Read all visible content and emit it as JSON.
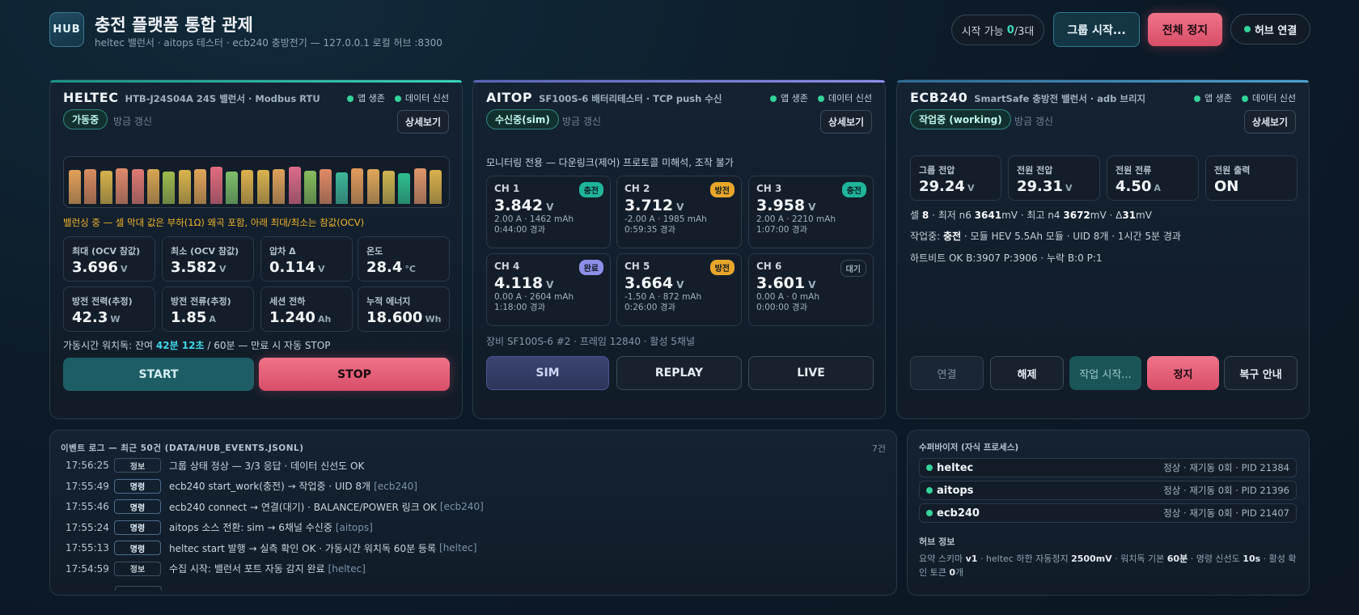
{
  "header": {
    "logo": "HUB",
    "title": "충전 플랫폼 통합 관제",
    "subtitle": "heltec 밸런서 · aitops 테스터 · ecb240 충방전기 — 127.0.0.1 로컬 허브 :8300",
    "start_avail_label": "시작 가능",
    "start_avail_count": "0",
    "start_avail_total": "/3대",
    "group_start": "그룹 시작...",
    "stop_all": "전체 정지",
    "hub_link": "허브 연결"
  },
  "heltec": {
    "name": "HELTEC",
    "desc": "HTB-J24S04A 24S 밸런서 · Modbus RTU",
    "alive": "앱 생존",
    "fresh": "데이터 신선",
    "state": "가동중",
    "refresh": "방금 갱신",
    "detail": "상세보기",
    "note": "밸런싱 중 — 셀 막대 값은 부하(1Ω) 왜곡 포함, 아래 최대/최소는 참값(OCV)",
    "stats": [
      {
        "label": "최대 (OCV 참값)",
        "value": "3.696",
        "unit": "V"
      },
      {
        "label": "최소 (OCV 참값)",
        "value": "3.582",
        "unit": "V"
      },
      {
        "label": "압차 Δ",
        "value": "0.114",
        "unit": "V"
      },
      {
        "label": "온도",
        "value": "28.4",
        "unit": "°C"
      },
      {
        "label": "방전 전력(추정)",
        "value": "42.3",
        "unit": "W"
      },
      {
        "label": "방전 전류(추정)",
        "value": "1.85",
        "unit": "A"
      },
      {
        "label": "세션 전하",
        "value": "1.240",
        "unit": "Ah"
      },
      {
        "label": "누적 에너지",
        "value": "18.600",
        "unit": "Wh"
      }
    ],
    "watchdog_pre": "가동시간 워치독: 잔여",
    "watchdog_time": "42분 12초",
    "watchdog_post": "/ 60분 — 만료 시 자동 STOP",
    "start": "START",
    "stop": "STOP",
    "cell_bars": [
      {
        "level": 0.78,
        "color": "#e3a15a"
      },
      {
        "level": 0.8,
        "color": "#d98b5f"
      },
      {
        "level": 0.76,
        "color": "#d6b24a"
      },
      {
        "level": 0.82,
        "color": "#e0896a"
      },
      {
        "level": 0.8,
        "color": "#e07a72"
      },
      {
        "level": 0.79,
        "color": "#d8a552"
      },
      {
        "level": 0.74,
        "color": "#9dbb4e"
      },
      {
        "level": 0.78,
        "color": "#d9b44b"
      },
      {
        "level": 0.79,
        "color": "#e2a458"
      },
      {
        "level": 0.85,
        "color": "#e16b7e"
      },
      {
        "level": 0.74,
        "color": "#7ec06a"
      },
      {
        "level": 0.78,
        "color": "#dcb14c"
      },
      {
        "level": 0.77,
        "color": "#dab24e"
      },
      {
        "level": 0.8,
        "color": "#dfa25b"
      },
      {
        "level": 0.86,
        "color": "#dc6b88"
      },
      {
        "level": 0.75,
        "color": "#86bd5d"
      },
      {
        "level": 0.8,
        "color": "#e08a66"
      },
      {
        "level": 0.72,
        "color": "#3fb69a"
      },
      {
        "level": 0.82,
        "color": "#e29c5d"
      },
      {
        "level": 0.8,
        "color": "#dfa75a"
      },
      {
        "level": 0.76,
        "color": "#cdb650"
      },
      {
        "level": 0.7,
        "color": "#2fbf8f"
      },
      {
        "level": 0.81,
        "color": "#e0966a"
      },
      {
        "level": 0.78,
        "color": "#d9b14b"
      }
    ]
  },
  "aitop": {
    "name": "AITOP",
    "desc": "SF100S-6 배터리테스터 · TCP push 수신",
    "alive": "앱 생존",
    "fresh": "데이터 신선",
    "state": "수신중(sim)",
    "refresh": "방금 갱신",
    "detail": "상세보기",
    "note": "모니터링 전용 — 다운링크(제어) 프로토콜 미해석, 조작 불가",
    "channels": [
      {
        "name": "CH 1",
        "badge": "충전",
        "voltage": "3.842",
        "unit": "V",
        "line1": "2.00 A · 1462 mAh",
        "line2": "0:44:00 경과",
        "badge_color": "#1fb59a"
      },
      {
        "name": "CH 2",
        "badge": "방전",
        "voltage": "3.712",
        "unit": "V",
        "line1": "-2.00 A · 1985 mAh",
        "line2": "0:59:35 경과",
        "badge_color": "#e8a72b"
      },
      {
        "name": "CH 3",
        "badge": "충전",
        "voltage": "3.958",
        "unit": "V",
        "line1": "2.00 A · 2210 mAh",
        "line2": "1:07:00 경과",
        "badge_color": "#1fb59a"
      },
      {
        "name": "CH 4",
        "badge": "완료",
        "voltage": "4.118",
        "unit": "V",
        "line1": "0.00 A · 2604 mAh",
        "line2": "1:18:00 경과",
        "badge_color": "#8d8ee8"
      },
      {
        "name": "CH 5",
        "badge": "방전",
        "voltage": "3.664",
        "unit": "V",
        "line1": "-1.50 A · 872 mAh",
        "line2": "0:26:00 경과",
        "badge_color": "#e8a72b"
      },
      {
        "name": "CH 6",
        "badge": "대기",
        "voltage": "3.601",
        "unit": "V",
        "line1": "0.00 A · 0 mAh",
        "line2": "0:00:00 경과",
        "badge_color": "#3a4a5c"
      }
    ],
    "footer": "장비 SF100S-6 #2 · 프레임 12840 · 활성 5채널",
    "sim": "SIM",
    "replay": "REPLAY",
    "live": "LIVE"
  },
  "ecb": {
    "name": "ECB240",
    "desc": "SmartSafe 충방전 밸런서 · adb 브리지",
    "alive": "앱 생존",
    "fresh": "데이터 신선",
    "state": "작업중 (working)",
    "refresh": "방금 갱신",
    "detail": "상세보기",
    "stats": [
      {
        "label": "그룹 전압",
        "value": "29.24",
        "unit": "V"
      },
      {
        "label": "전원 전압",
        "value": "29.31",
        "unit": "V"
      },
      {
        "label": "전원 전류",
        "value": "4.50",
        "unit": "A"
      },
      {
        "label": "전원 출력",
        "value": "ON",
        "unit": ""
      }
    ],
    "cells_line": {
      "p1": "셀",
      "cells": "8",
      "p2": "· 최저 n6",
      "min": "3641",
      "p3": "mV · 최고 n4",
      "max": "3672",
      "p4": "mV · Δ",
      "delta": "31",
      "p5": "mV"
    },
    "work_line": {
      "p1": "작업중:",
      "mode": "충전",
      "p2": "· 모듈 HEV 5.5Ah 모듈 · UID 8개 · 1시간 5분 경과"
    },
    "heartbeat": "하트비트 OK B:3907 P:3906 · 누락 B:0 P:1",
    "btn_connect": "연결",
    "btn_release": "해제",
    "btn_work": "작업 시작...",
    "btn_stop": "정지",
    "btn_recover": "복구 안내"
  },
  "log": {
    "title": "이벤트 로그 — 최근 50건 (DATA/HUB_EVENTS.JSONL)",
    "count": "7건",
    "rows": [
      {
        "time": "17:56:25",
        "kind": "정보",
        "msg": "그룹 상태 정상 — 3/3 응답 · 데이터 신선도 OK",
        "src": ""
      },
      {
        "time": "17:55:49",
        "kind": "명령",
        "msg": "ecb240 start_work(충전) → 작업중 · UID 8개",
        "src": "[ecb240]"
      },
      {
        "time": "17:55:46",
        "kind": "명령",
        "msg": "ecb240 connect → 연결(대기) · BALANCE/POWER 링크 OK",
        "src": "[ecb240]"
      },
      {
        "time": "17:55:24",
        "kind": "명령",
        "msg": "aitops 소스 전환: sim → 6채널 수신중",
        "src": "[aitops]"
      },
      {
        "time": "17:55:13",
        "kind": "명령",
        "msg": "heltec start 발행 → 실측 확인 OK · 가동시간 워치독 60분 등록",
        "src": "[heltec]"
      },
      {
        "time": "17:54:59",
        "kind": "정보",
        "msg": "수집 시작: 밸런서 포트 자동 감지 완료",
        "src": "[heltec]"
      }
    ]
  },
  "supervisor": {
    "title": "수퍼바이저 (자식 프로세스)",
    "procs": [
      {
        "name": "heltec",
        "status": "정상 · 재기동 0회 · PID 21384"
      },
      {
        "name": "aitops",
        "status": "정상 · 재기동 0회 · PID 21396"
      },
      {
        "name": "ecb240",
        "status": "정상 · 재기동 0회 · PID 21407"
      }
    ],
    "hub_title": "허브 정보",
    "hub": {
      "p1": "요약 스키마",
      "schema": "v1",
      "p2": "· heltec 하한 자동정지",
      "cutoff": "2500mV",
      "p3": "· 워치독 기본",
      "wd": "60분",
      "p4": "· 명령 신선도",
      "fresh": "10s",
      "p5": "· 활성 확인 토큰",
      "tokens": "0",
      "p6": "개"
    }
  }
}
